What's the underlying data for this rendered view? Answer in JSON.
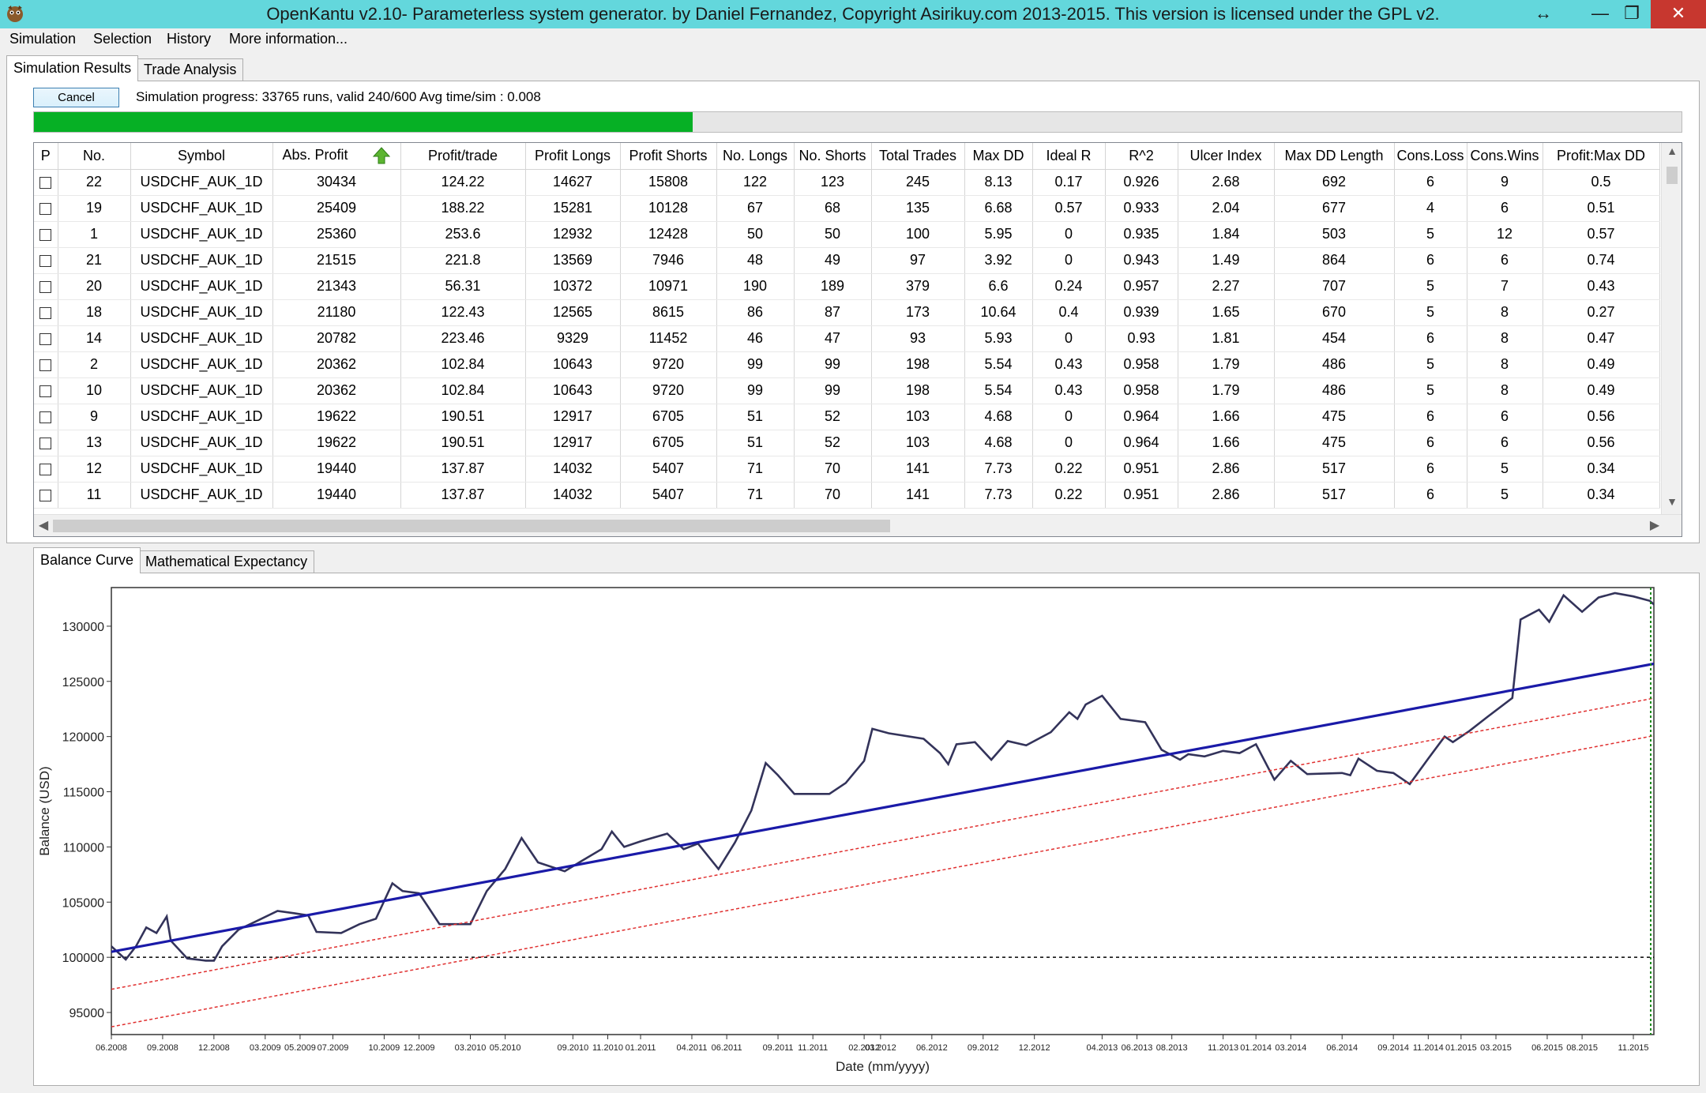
{
  "window": {
    "title": "OpenKantu v2.10- Parameterless system generator. by Daniel Fernandez, Copyright Asirikuy.com 2013-2015. This version is licensed under the GPL v2.",
    "resize_glyph": "↔",
    "minimize_glyph": "—",
    "maximize_glyph": "❐",
    "close_glyph": "✕"
  },
  "menu": [
    "Simulation",
    "Selection",
    "History",
    "More information..."
  ],
  "top_tabs": [
    "Simulation Results",
    "Trade Analysis"
  ],
  "progress": {
    "cancel_label": "Cancel",
    "label": "Simulation progress: 33765  runs, valid 240/600 Avg time/sim : 0.008",
    "fraction": 0.4
  },
  "grid": {
    "columns": [
      "P",
      "No.",
      "Symbol",
      "Abs. Profit",
      "Profit/trade",
      "Profit Longs",
      "Profit Shorts",
      "No. Longs",
      "No. Shorts",
      "Total Trades",
      "Max DD",
      "Ideal R",
      "R^2",
      "Ulcer Index",
      "Max DD Length",
      "Cons.Loss",
      "Cons.Wins",
      "Profit:Max DD"
    ],
    "rows": [
      [
        "22",
        "USDCHF_AUK_1D",
        "30434",
        "124.22",
        "14627",
        "15808",
        "122",
        "123",
        "245",
        "8.13",
        "0.17",
        "0.926",
        "2.68",
        "692",
        "6",
        "9",
        "0.5"
      ],
      [
        "19",
        "USDCHF_AUK_1D",
        "25409",
        "188.22",
        "15281",
        "10128",
        "67",
        "68",
        "135",
        "6.68",
        "0.57",
        "0.933",
        "2.04",
        "677",
        "4",
        "6",
        "0.51"
      ],
      [
        "1",
        "USDCHF_AUK_1D",
        "25360",
        "253.6",
        "12932",
        "12428",
        "50",
        "50",
        "100",
        "5.95",
        "0",
        "0.935",
        "1.84",
        "503",
        "5",
        "12",
        "0.57"
      ],
      [
        "21",
        "USDCHF_AUK_1D",
        "21515",
        "221.8",
        "13569",
        "7946",
        "48",
        "49",
        "97",
        "3.92",
        "0",
        "0.943",
        "1.49",
        "864",
        "6",
        "6",
        "0.74"
      ],
      [
        "20",
        "USDCHF_AUK_1D",
        "21343",
        "56.31",
        "10372",
        "10971",
        "190",
        "189",
        "379",
        "6.6",
        "0.24",
        "0.957",
        "2.27",
        "707",
        "5",
        "7",
        "0.43"
      ],
      [
        "18",
        "USDCHF_AUK_1D",
        "21180",
        "122.43",
        "12565",
        "8615",
        "86",
        "87",
        "173",
        "10.64",
        "0.4",
        "0.939",
        "1.65",
        "670",
        "5",
        "8",
        "0.27"
      ],
      [
        "14",
        "USDCHF_AUK_1D",
        "20782",
        "223.46",
        "9329",
        "11452",
        "46",
        "47",
        "93",
        "5.93",
        "0",
        "0.93",
        "1.81",
        "454",
        "6",
        "8",
        "0.47"
      ],
      [
        "2",
        "USDCHF_AUK_1D",
        "20362",
        "102.84",
        "10643",
        "9720",
        "99",
        "99",
        "198",
        "5.54",
        "0.43",
        "0.958",
        "1.79",
        "486",
        "5",
        "8",
        "0.49"
      ],
      [
        "10",
        "USDCHF_AUK_1D",
        "20362",
        "102.84",
        "10643",
        "9720",
        "99",
        "99",
        "198",
        "5.54",
        "0.43",
        "0.958",
        "1.79",
        "486",
        "5",
        "8",
        "0.49"
      ],
      [
        "9",
        "USDCHF_AUK_1D",
        "19622",
        "190.51",
        "12917",
        "6705",
        "51",
        "52",
        "103",
        "4.68",
        "0",
        "0.964",
        "1.66",
        "475",
        "6",
        "6",
        "0.56"
      ],
      [
        "13",
        "USDCHF_AUK_1D",
        "19622",
        "190.51",
        "12917",
        "6705",
        "51",
        "52",
        "103",
        "4.68",
        "0",
        "0.964",
        "1.66",
        "475",
        "6",
        "6",
        "0.56"
      ],
      [
        "12",
        "USDCHF_AUK_1D",
        "19440",
        "137.87",
        "14032",
        "5407",
        "71",
        "70",
        "141",
        "7.73",
        "0.22",
        "0.951",
        "2.86",
        "517",
        "6",
        "5",
        "0.34"
      ],
      [
        "11",
        "USDCHF_AUK_1D",
        "19440",
        "137.87",
        "14032",
        "5407",
        "71",
        "70",
        "141",
        "7.73",
        "0.22",
        "0.951",
        "2.86",
        "517",
        "6",
        "5",
        "0.34"
      ]
    ]
  },
  "bottom_tabs": [
    "Balance Curve",
    "Mathematical Expectancy"
  ],
  "chart_data": {
    "type": "line",
    "title": "",
    "xlabel": "Date (mm/yyyy)",
    "ylabel": "Balance (USD)",
    "ylim": [
      93000,
      133500
    ],
    "xlim": [
      2008.46,
      2015.98
    ],
    "yticks": [
      95000,
      100000,
      105000,
      110000,
      115000,
      120000,
      125000,
      130000
    ],
    "ytick_labels": [
      "95000",
      "100000",
      "105000",
      "110000",
      "115000",
      "120000",
      "125000",
      "130000"
    ],
    "xticks": [
      {
        "x": 2008.46,
        "label": "06.2008"
      },
      {
        "x": 2008.71,
        "label": "09.2008"
      },
      {
        "x": 2008.96,
        "label": "12.2008"
      },
      {
        "x": 2009.21,
        "label": "03.2009"
      },
      {
        "x": 2009.38,
        "label": "05.2009"
      },
      {
        "x": 2009.54,
        "label": "07.2009"
      },
      {
        "x": 2009.79,
        "label": "10.2009"
      },
      {
        "x": 2009.96,
        "label": "12.2009"
      },
      {
        "x": 2010.21,
        "label": "03.2010"
      },
      {
        "x": 2010.38,
        "label": "05.2010"
      },
      {
        "x": 2010.71,
        "label": "09.2010"
      },
      {
        "x": 2010.88,
        "label": "11.2010"
      },
      {
        "x": 2011.04,
        "label": "01.2011"
      },
      {
        "x": 2011.29,
        "label": "04.2011"
      },
      {
        "x": 2011.46,
        "label": "06.2011"
      },
      {
        "x": 2011.71,
        "label": "09.2011"
      },
      {
        "x": 2011.88,
        "label": "11.2011"
      },
      {
        "x": 2012.13,
        "label": "02.2012"
      },
      {
        "x": 2012.21,
        "label": "03.2012"
      },
      {
        "x": 2012.46,
        "label": "06.2012"
      },
      {
        "x": 2012.71,
        "label": "09.2012"
      },
      {
        "x": 2012.96,
        "label": "12.2012"
      },
      {
        "x": 2013.29,
        "label": "04.2013"
      },
      {
        "x": 2013.46,
        "label": "06.2013"
      },
      {
        "x": 2013.63,
        "label": "08.2013"
      },
      {
        "x": 2013.88,
        "label": "11.2013"
      },
      {
        "x": 2014.04,
        "label": "01.2014"
      },
      {
        "x": 2014.21,
        "label": "03.2014"
      },
      {
        "x": 2014.46,
        "label": "06.2014"
      },
      {
        "x": 2014.71,
        "label": "09.2014"
      },
      {
        "x": 2014.88,
        "label": "11.2014"
      },
      {
        "x": 2015.04,
        "label": "01.2015"
      },
      {
        "x": 2015.21,
        "label": "03.2015"
      },
      {
        "x": 2015.46,
        "label": "06.2015"
      },
      {
        "x": 2015.63,
        "label": "08.2015"
      },
      {
        "x": 2015.88,
        "label": "11.2015"
      }
    ],
    "series": [
      {
        "color": "#33335a",
        "points": [
          [
            2008.46,
            101000
          ],
          [
            2008.53,
            99800
          ],
          [
            2008.58,
            101000
          ],
          [
            2008.63,
            102700
          ],
          [
            2008.68,
            102200
          ],
          [
            2008.73,
            103700
          ],
          [
            2008.75,
            101500
          ],
          [
            2008.83,
            99900
          ],
          [
            2008.92,
            99700
          ],
          [
            2008.96,
            99700
          ],
          [
            2009.0,
            101000
          ],
          [
            2009.08,
            102500
          ],
          [
            2009.17,
            103300
          ],
          [
            2009.27,
            104200
          ],
          [
            2009.35,
            104000
          ],
          [
            2009.42,
            103800
          ],
          [
            2009.46,
            102300
          ],
          [
            2009.58,
            102200
          ],
          [
            2009.67,
            103000
          ],
          [
            2009.75,
            103500
          ],
          [
            2009.83,
            106700
          ],
          [
            2009.88,
            106000
          ],
          [
            2009.96,
            105800
          ],
          [
            2010.0,
            104700
          ],
          [
            2010.06,
            103000
          ],
          [
            2010.21,
            103000
          ],
          [
            2010.29,
            106000
          ],
          [
            2010.38,
            108000
          ],
          [
            2010.46,
            110800
          ],
          [
            2010.54,
            108600
          ],
          [
            2010.67,
            107800
          ],
          [
            2010.75,
            108700
          ],
          [
            2010.85,
            109800
          ],
          [
            2010.9,
            111400
          ],
          [
            2010.96,
            110000
          ],
          [
            2011.04,
            110500
          ],
          [
            2011.17,
            111200
          ],
          [
            2011.25,
            109800
          ],
          [
            2011.32,
            110300
          ],
          [
            2011.42,
            108000
          ],
          [
            2011.5,
            110400
          ],
          [
            2011.58,
            113300
          ],
          [
            2011.65,
            117600
          ],
          [
            2011.71,
            116500
          ],
          [
            2011.79,
            114800
          ],
          [
            2011.96,
            114800
          ],
          [
            2012.04,
            115800
          ],
          [
            2012.13,
            117800
          ],
          [
            2012.17,
            120700
          ],
          [
            2012.25,
            120300
          ],
          [
            2012.42,
            119800
          ],
          [
            2012.5,
            118500
          ],
          [
            2012.54,
            117500
          ],
          [
            2012.58,
            119300
          ],
          [
            2012.67,
            119500
          ],
          [
            2012.75,
            117900
          ],
          [
            2012.83,
            119600
          ],
          [
            2012.92,
            119200
          ],
          [
            2013.04,
            120400
          ],
          [
            2013.13,
            122200
          ],
          [
            2013.17,
            121600
          ],
          [
            2013.21,
            122900
          ],
          [
            2013.29,
            123700
          ],
          [
            2013.38,
            121600
          ],
          [
            2013.5,
            121300
          ],
          [
            2013.58,
            118800
          ],
          [
            2013.67,
            117900
          ],
          [
            2013.71,
            118400
          ],
          [
            2013.79,
            118200
          ],
          [
            2013.88,
            118700
          ],
          [
            2013.96,
            118500
          ],
          [
            2014.04,
            119300
          ],
          [
            2014.13,
            116100
          ],
          [
            2014.21,
            117800
          ],
          [
            2014.29,
            116600
          ],
          [
            2014.46,
            116700
          ],
          [
            2014.5,
            116500
          ],
          [
            2014.54,
            118000
          ],
          [
            2014.63,
            116900
          ],
          [
            2014.71,
            116700
          ],
          [
            2014.79,
            115700
          ],
          [
            2014.88,
            118000
          ],
          [
            2014.96,
            120000
          ],
          [
            2015.0,
            119500
          ],
          [
            2015.08,
            120500
          ],
          [
            2015.17,
            121800
          ],
          [
            2015.29,
            123500
          ],
          [
            2015.33,
            130600
          ],
          [
            2015.42,
            131500
          ],
          [
            2015.47,
            130400
          ],
          [
            2015.54,
            132800
          ],
          [
            2015.63,
            131300
          ],
          [
            2015.71,
            132600
          ],
          [
            2015.79,
            133000
          ],
          [
            2015.88,
            132700
          ],
          [
            2015.96,
            132300
          ],
          [
            2016.04,
            131000
          ],
          [
            2016.13,
            129200
          ],
          [
            2016.21,
            129000
          ],
          [
            2016.29,
            129300
          ],
          [
            2016.38,
            129700
          ],
          [
            2016.5,
            130500
          ]
        ]
      },
      {
        "color": "#1a1aa8",
        "points": [
          [
            2008.46,
            100500
          ],
          [
            2016.5,
            128400
          ]
        ]
      },
      {
        "color": "#e03030",
        "dashed": true,
        "points": [
          [
            2008.46,
            97100
          ],
          [
            2016.5,
            125300
          ]
        ]
      },
      {
        "color": "#e03030",
        "dashed": true,
        "points": [
          [
            2008.46,
            93700
          ],
          [
            2016.5,
            121900
          ]
        ]
      }
    ],
    "reference_line": {
      "y": 100000,
      "color": "#000000",
      "dashed": true
    },
    "end_marker_color": "#1c8c1c",
    "grid": false,
    "legend": "none"
  }
}
